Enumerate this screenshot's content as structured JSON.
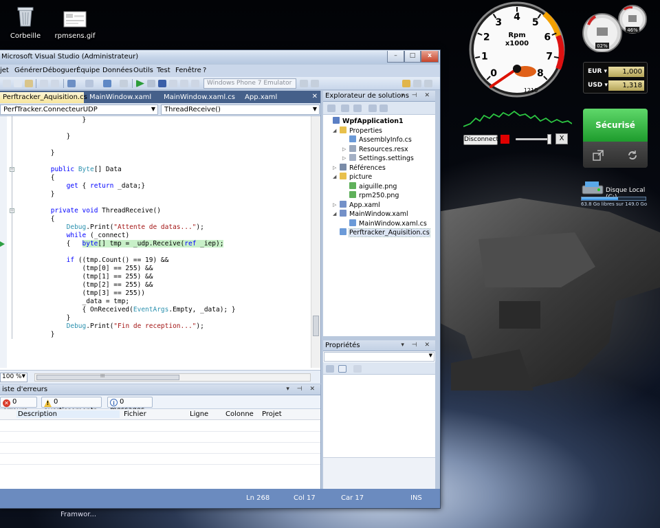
{
  "desktop": {
    "icons": [
      {
        "label": "Corbeille"
      },
      {
        "label": "rpmsens.gif"
      }
    ],
    "taskbar_fragment": "Framwor..."
  },
  "vs": {
    "title": "Microsoft Visual Studio (Administrateur)",
    "window_buttons": {
      "minimize": "–",
      "maximize": "□",
      "close": "x"
    },
    "menu": [
      "jet",
      "Générer",
      "Déboguer",
      "Équipe",
      "Données",
      "Outils",
      "Test",
      "Fenêtre",
      "?"
    ],
    "toolbar": {
      "emulator": "Windows Phone 7 Emulator"
    },
    "tabs": [
      "Perftracker_Aquisition.cs",
      "MainWindow.xaml",
      "MainWindow.xaml.cs",
      "App.xaml"
    ],
    "nav": {
      "class": "PerfTracker.ConnecteurUDP",
      "member": "ThreadReceive()"
    },
    "code": [
      "                }",
      "",
      "            }",
      "",
      "        }",
      "",
      "        public Byte[] Data",
      "        {",
      "            get { return _data;}",
      "        }",
      "",
      "        private void ThreadReceive()",
      "        {",
      "            Debug.Print(\"Attente de datas...\");",
      "            while (_connect)",
      "            {   byte[] tmp = _udp.Receive(ref _iep);",
      "",
      "            if ((tmp.Count() == 19) &&",
      "                (tmp[0] == 255) &&",
      "                (tmp[1] == 255) &&",
      "                (tmp[2] == 255) &&",
      "                (tmp[3] == 255))",
      "                _data = tmp;",
      "                { OnReceived(EventArgs.Empty, _data); }",
      "            }",
      "            Debug.Print(\"Fin de reception...\");",
      "        }"
    ],
    "zoom": "100 %",
    "scroll_marker": "III",
    "error_list": {
      "title": "iste d'erreurs",
      "errors": "0 erreurs",
      "warnings": "0 avertissements",
      "messages": "0 messages",
      "columns": [
        "Description",
        "Fichier",
        "Ligne",
        "Colonne",
        "Projet"
      ]
    },
    "solution_explorer": {
      "title": "Explorateur de solutions",
      "items": [
        {
          "label": "WpfApplication1",
          "icon": "project-icon"
        },
        {
          "label": "Properties",
          "icon": "folder-icon"
        },
        {
          "label": "AssemblyInfo.cs",
          "icon": "cs-file-icon"
        },
        {
          "label": "Resources.resx",
          "icon": "resx-file-icon"
        },
        {
          "label": "Settings.settings",
          "icon": "settings-file-icon"
        },
        {
          "label": "Références",
          "icon": "references-icon"
        },
        {
          "label": "picture",
          "icon": "folder-icon"
        },
        {
          "label": "aiguille.png",
          "icon": "image-file-icon"
        },
        {
          "label": "rpm250.png",
          "icon": "image-file-icon"
        },
        {
          "label": "App.xaml",
          "icon": "xaml-file-icon"
        },
        {
          "label": "MainWindow.xaml",
          "icon": "xaml-file-icon"
        },
        {
          "label": "MainWindow.xaml.cs",
          "icon": "cs-file-icon"
        },
        {
          "label": "Perftracker_Aquisition.cs",
          "icon": "cs-file-icon"
        }
      ]
    },
    "properties": {
      "title": "Propriétés"
    },
    "status": {
      "line": "Ln 268",
      "col": "Col 17",
      "char": "Car 17",
      "mode": "INS"
    }
  },
  "gadgets": {
    "rpm_gauge": {
      "ticks": [
        "0",
        "1",
        "2",
        "3",
        "4",
        "5",
        "6",
        "7",
        "8"
      ],
      "unit_top": "Rpm",
      "unit_bottom": "x1000",
      "reading": "1210"
    },
    "cpu_meter": {
      "left": "02%",
      "right": "46%"
    },
    "controls": {
      "disconnect": "Disconnect",
      "close": "X"
    },
    "slider_value": 0.9,
    "currency": [
      {
        "code": "EUR",
        "value": "1,000"
      },
      {
        "code": "USD",
        "value": "1,318"
      }
    ],
    "secure": {
      "label": "Sécurisé"
    },
    "disk": {
      "name": "Disque Local (C:)",
      "free": "63.8 Go libres sur 149.0 Go",
      "fill_fraction": 0.57
    }
  }
}
